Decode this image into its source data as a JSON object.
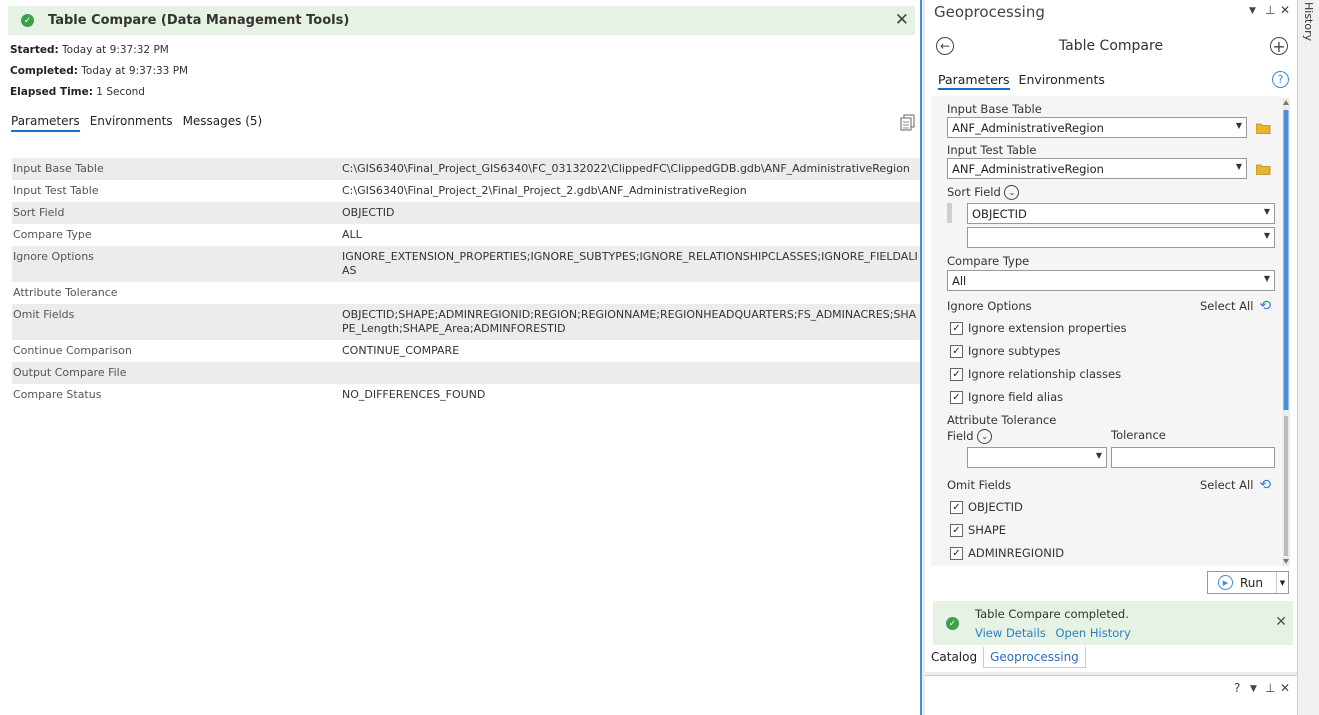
{
  "details": {
    "title": "Table Compare (Data Management Tools)",
    "started_label": "Started:",
    "started_value": "Today at 9:37:32 PM",
    "completed_label": "Completed:",
    "completed_value": "Today at 9:37:33 PM",
    "elapsed_label": "Elapsed Time:",
    "elapsed_value": "1 Second",
    "tabs": [
      "Parameters",
      "Environments",
      "Messages (5)"
    ],
    "rows": [
      {
        "name": "Input Base Table",
        "value": "C:\\GIS6340\\Final_Project_GIS6340\\FC_03132022\\ClippedFC\\ClippedGDB.gdb\\ANF_AdministrativeRegion"
      },
      {
        "name": "Input Test Table",
        "value": "C:\\GIS6340\\Final_Project_2\\Final_Project_2.gdb\\ANF_AdministrativeRegion"
      },
      {
        "name": "Sort Field",
        "value": "OBJECTID"
      },
      {
        "name": "Compare Type",
        "value": "ALL"
      },
      {
        "name": "Ignore Options",
        "value": "IGNORE_EXTENSION_PROPERTIES;IGNORE_SUBTYPES;IGNORE_RELATIONSHIPCLASSES;IGNORE_FIELDALIAS"
      },
      {
        "name": "Attribute Tolerance",
        "value": ""
      },
      {
        "name": "Omit Fields",
        "value": "OBJECTID;SHAPE;ADMINREGIONID;REGION;REGIONNAME;REGIONHEADQUARTERS;FS_ADMINACRES;SHAPE_Length;SHAPE_Area;ADMINFORESTID"
      },
      {
        "name": "Continue Comparison",
        "value": "CONTINUE_COMPARE"
      },
      {
        "name": "Output Compare File",
        "value": ""
      },
      {
        "name": "Compare Status",
        "value": "NO_DIFFERENCES_FOUND"
      }
    ]
  },
  "gp": {
    "pane_title": "Geoprocessing",
    "tool_name": "Table Compare",
    "tabs": [
      "Parameters",
      "Environments"
    ],
    "input_base_label": "Input Base Table",
    "input_base_value": "ANF_AdministrativeRegion",
    "input_test_label": "Input Test Table",
    "input_test_value": "ANF_AdministrativeRegion",
    "sort_field_label": "Sort Field",
    "sort_field_1": "OBJECTID",
    "sort_field_2": "",
    "compare_type_label": "Compare Type",
    "compare_type_value": "All",
    "ignore_options_label": "Ignore Options",
    "select_all": "Select All",
    "ignore_options": [
      "Ignore extension properties",
      "Ignore subtypes",
      "Ignore relationship classes",
      "Ignore field alias"
    ],
    "attr_tol_label": "Attribute Tolerance",
    "field_label": "Field",
    "tolerance_label": "Tolerance",
    "omit_fields_label": "Omit Fields",
    "omit_fields": [
      "OBJECTID",
      "SHAPE",
      "ADMINREGIONID"
    ],
    "run_label": "Run",
    "notice_msg": "Table Compare completed.",
    "view_details": "View Details",
    "open_history": "Open History",
    "bottom_tabs": [
      "Catalog",
      "Geoprocessing"
    ],
    "history_label": "History",
    "help_glyph": "?",
    "pin_glyph": "📌"
  },
  "colors": {
    "accent": "#1e6cc8",
    "success_bg": "#e6f2e3",
    "success": "#38a14a"
  }
}
